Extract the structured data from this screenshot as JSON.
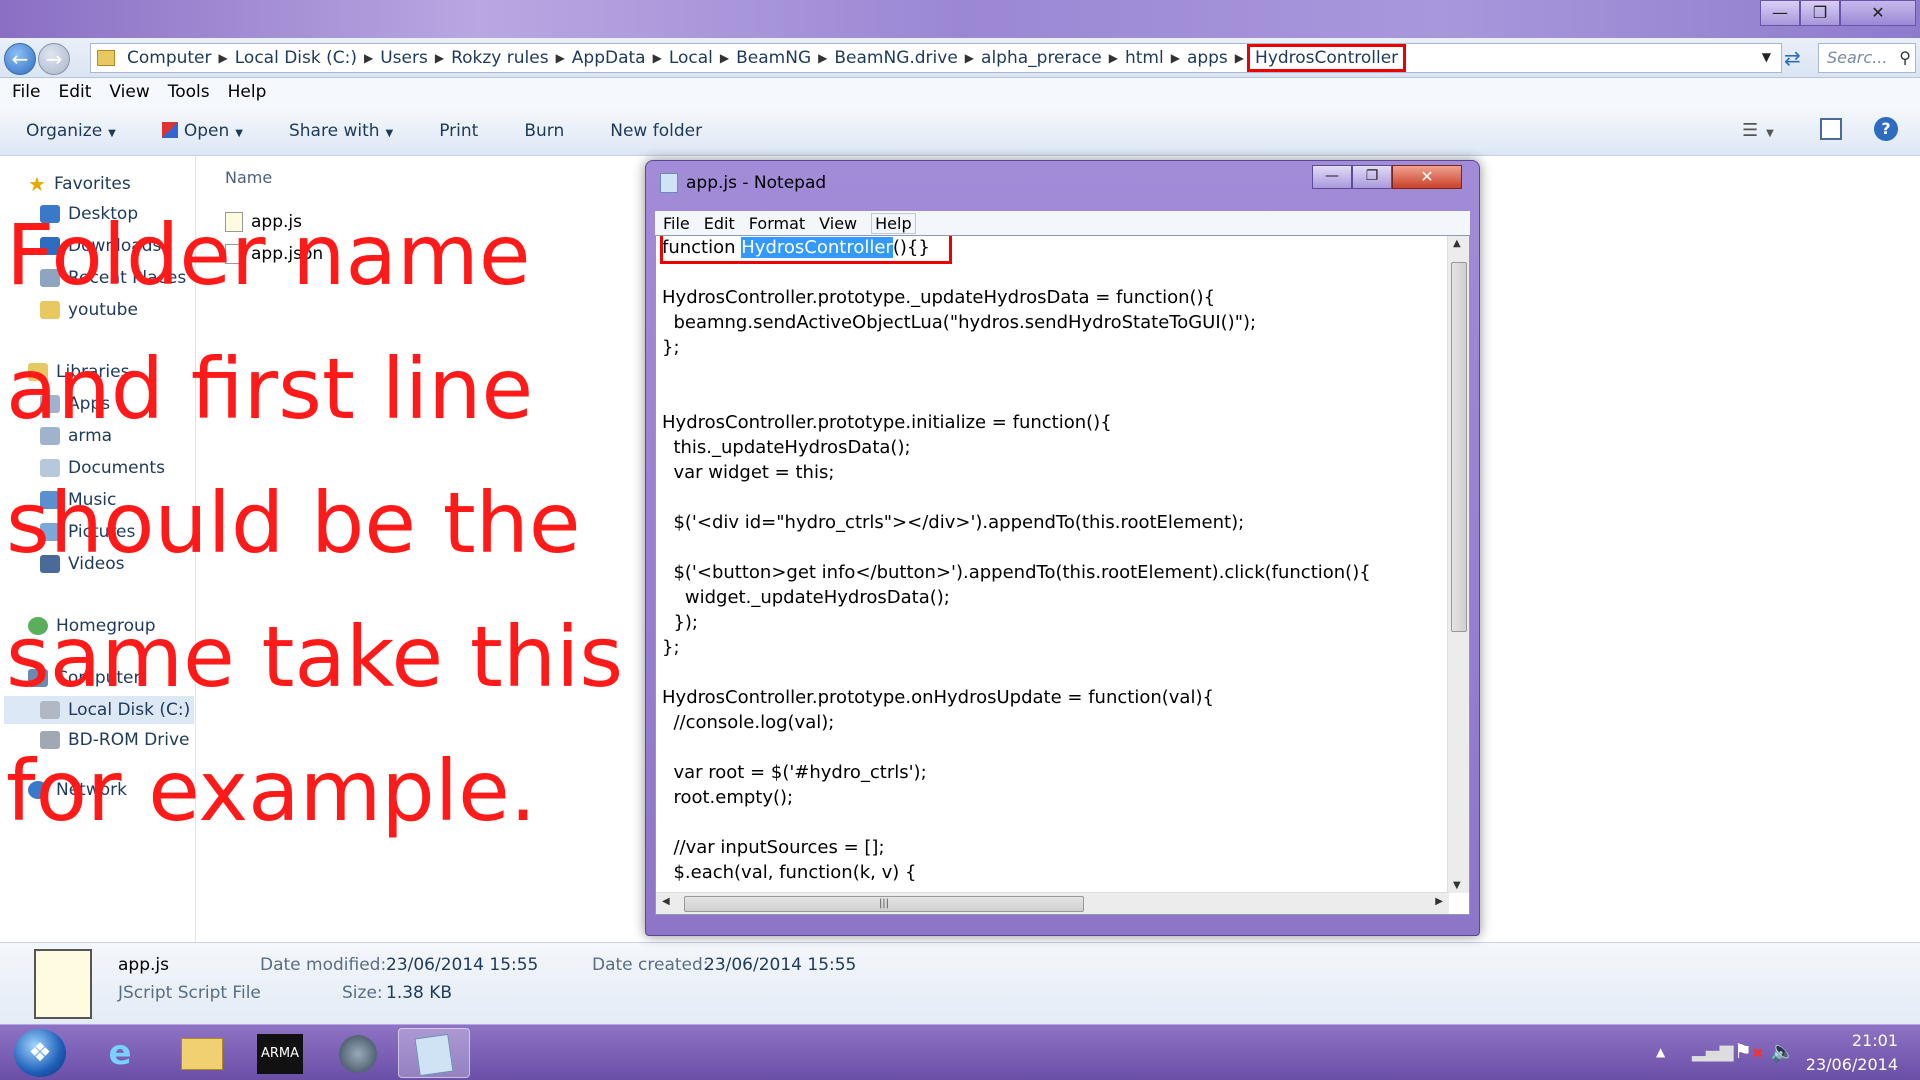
{
  "colors": {
    "annotation": "#ff1a1a",
    "highlight_box": "#e00000",
    "selection": "#3399ff",
    "taskbar": "#7a5fb6"
  },
  "explorer": {
    "breadcrumbs": [
      "Computer",
      "Local Disk (C:)",
      "Users",
      "Rokzy rules",
      "AppData",
      "Local",
      "BeamNG",
      "BeamNG.drive",
      "alpha_prerace",
      "html",
      "apps",
      "HydrosController"
    ],
    "search_placeholder": "Searc...",
    "menu": [
      "File",
      "Edit",
      "View",
      "Tools",
      "Help"
    ],
    "toolbar": {
      "organize": "Organize",
      "open": "Open",
      "share": "Share with",
      "print": "Print",
      "burn": "Burn",
      "new_folder": "New folder"
    },
    "nav": {
      "favorites": "Favorites",
      "desktop": "Desktop",
      "downloads": "Downloads",
      "recent": "Recent Places",
      "youtube": "youtube",
      "libraries": "Libraries",
      "apps": "Apps",
      "arma": "arma",
      "documents": "Documents",
      "music": "Music",
      "pictures": "Pictures",
      "videos": "Videos",
      "homegroup": "Homegroup",
      "computer": "Computer",
      "localdisk": "Local Disk (C:)",
      "bdrom": "BD-ROM Drive (",
      "network": "Network"
    },
    "column_name": "Name",
    "files": [
      "app.js",
      "app.json"
    ],
    "details": {
      "filename": "app.js",
      "filetype": "JScript Script File",
      "modified_label": "Date modified:",
      "modified_value": "23/06/2014 15:55",
      "size_label": "Size:",
      "size_value": "1.38 KB",
      "created_label": "Date created:",
      "created_value": "23/06/2014 15:55"
    }
  },
  "notepad": {
    "title": "app.js - Notepad",
    "menu": [
      "File",
      "Edit",
      "Format",
      "View",
      "Help"
    ],
    "first_line_prefix": "function ",
    "first_line_selected": "HydrosController",
    "first_line_suffix": "(){}",
    "lines": [
      "HydrosController.prototype._updateHydrosData = function(){",
      "  beamng.sendActiveObjectLua(\"hydros.sendHydroStateToGUI()\");",
      "};",
      "",
      "",
      "HydrosController.prototype.initialize = function(){",
      "  this._updateHydrosData();",
      "  var widget = this;",
      "",
      "  $('<div id=\"hydro_ctrls\"></div>').appendTo(this.rootElement);",
      "",
      "  $('<button>get info</button>').appendTo(this.rootElement).click(function(){",
      "    widget._updateHydrosData();",
      "  });",
      "};",
      "",
      "HydrosController.prototype.onHydrosUpdate = function(val){",
      "  //console.log(val);",
      "",
      "  var root = $('#hydro_ctrls');",
      "  root.empty();",
      "",
      "  //var inputSources = [];",
      "  $.each(val, function(k, v) {"
    ]
  },
  "annotation": [
    "Folder name",
    "and first line",
    "should be the",
    "same take this",
    "for example."
  ],
  "taskbar": {
    "time": "21:01",
    "date": "23/06/2014"
  }
}
